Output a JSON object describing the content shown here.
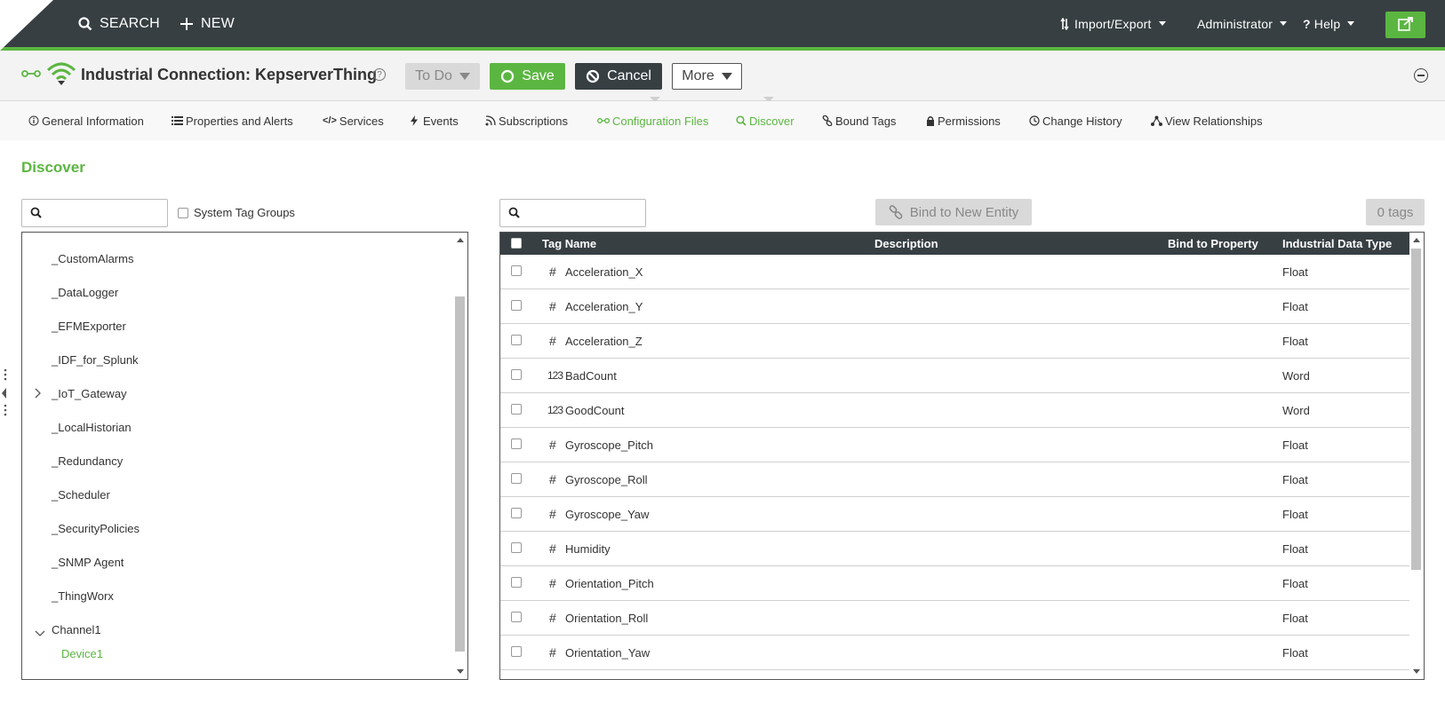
{
  "topbar": {
    "search_label": "SEARCH",
    "new_label": "NEW",
    "import_export_label": "Import/Export",
    "user_label": "Administrator",
    "help_label": "Help"
  },
  "entity": {
    "title": "Industrial Connection: KepserverThing",
    "help_glyph": "?",
    "todo_label": "To Do",
    "save_label": "Save",
    "cancel_label": "Cancel",
    "more_label": "More"
  },
  "tabs": [
    {
      "label": "General Information",
      "icon": "info-icon"
    },
    {
      "label": "Properties and Alerts",
      "icon": "list-icon"
    },
    {
      "label": "Services",
      "icon": "code-icon"
    },
    {
      "label": "Events",
      "icon": "lightning-icon"
    },
    {
      "label": "Subscriptions",
      "icon": "rss-icon"
    },
    {
      "label": "Configuration Files",
      "icon": "link-icon"
    },
    {
      "label": "Discover",
      "icon": "search-icon",
      "active": true
    },
    {
      "label": "Bound Tags",
      "icon": "link-icon"
    },
    {
      "label": "Permissions",
      "icon": "lock-icon"
    },
    {
      "label": "Change History",
      "icon": "clock-icon"
    },
    {
      "label": "View Relationships",
      "icon": "hierarchy-icon"
    }
  ],
  "discover": {
    "title": "Discover",
    "system_tag_groups_label": "System Tag Groups",
    "bind_button_label": "Bind to New Entity",
    "tags_count_label": "0 tags"
  },
  "tree": {
    "nodes": [
      {
        "label": "_CustomAlarms"
      },
      {
        "label": "_DataLogger"
      },
      {
        "label": "_EFMExporter"
      },
      {
        "label": "_IDF_for_Splunk"
      },
      {
        "label": "_IoT_Gateway",
        "expandable": true
      },
      {
        "label": "_LocalHistorian"
      },
      {
        "label": "_Redundancy"
      },
      {
        "label": "_Scheduler"
      },
      {
        "label": "_SecurityPolicies"
      },
      {
        "label": "_SNMP Agent"
      },
      {
        "label": "_ThingWorx"
      },
      {
        "label": "Channel1",
        "expanded": true
      },
      {
        "label": "Device1",
        "selected": true
      }
    ]
  },
  "grid": {
    "columns": [
      "Tag Name",
      "Description",
      "Bind to Property",
      "Industrial Data Type"
    ],
    "rows": [
      {
        "icon": "#",
        "name": "Acceleration_X",
        "type": "Float"
      },
      {
        "icon": "#",
        "name": "Acceleration_Y",
        "type": "Float"
      },
      {
        "icon": "#",
        "name": "Acceleration_Z",
        "type": "Float"
      },
      {
        "icon": "123",
        "name": "BadCount",
        "type": "Word"
      },
      {
        "icon": "123",
        "name": "GoodCount",
        "type": "Word"
      },
      {
        "icon": "#",
        "name": "Gyroscope_Pitch",
        "type": "Float"
      },
      {
        "icon": "#",
        "name": "Gyroscope_Roll",
        "type": "Float"
      },
      {
        "icon": "#",
        "name": "Gyroscope_Yaw",
        "type": "Float"
      },
      {
        "icon": "#",
        "name": "Humidity",
        "type": "Float"
      },
      {
        "icon": "#",
        "name": "Orientation_Pitch",
        "type": "Float"
      },
      {
        "icon": "#",
        "name": "Orientation_Roll",
        "type": "Float"
      },
      {
        "icon": "#",
        "name": "Orientation_Yaw",
        "type": "Float"
      }
    ]
  },
  "colors": {
    "accent_green": "#5bb641",
    "topbar_dark": "#373f43",
    "disabled_gray": "#d9d9d9"
  }
}
